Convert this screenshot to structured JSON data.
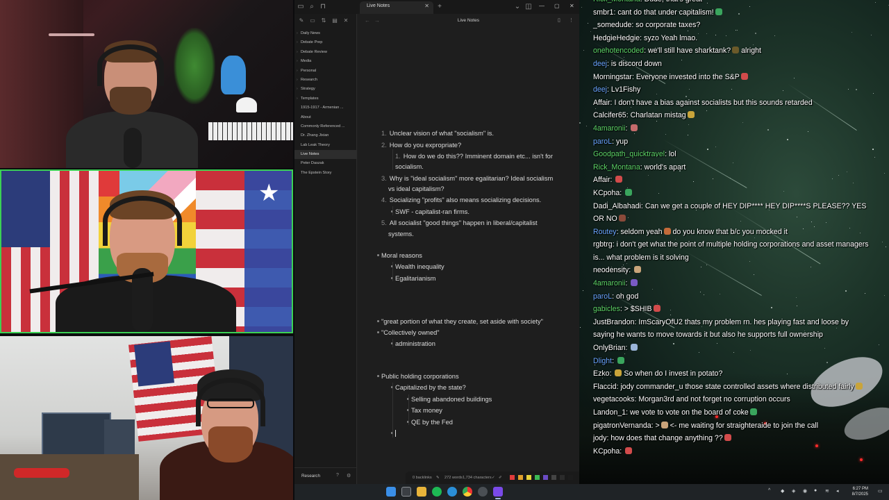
{
  "obsidian": {
    "tab_title": "Live Notes",
    "note_title": "Live Notes",
    "vault_name": "Research",
    "sidebar_items": [
      {
        "label": "Daily News",
        "folder": true
      },
      {
        "label": "Debate Prep",
        "folder": true
      },
      {
        "label": "Debate Review",
        "folder": true
      },
      {
        "label": "Media",
        "folder": true
      },
      {
        "label": "Personal",
        "folder": true
      },
      {
        "label": "Research",
        "folder": true
      },
      {
        "label": "Strategy",
        "folder": true
      },
      {
        "label": "Templates",
        "folder": true
      },
      {
        "label": "1915-1917 - Armenian ...",
        "folder": false
      },
      {
        "label": "About",
        "folder": false
      },
      {
        "label": "Commonly Referenced ...",
        "folder": false
      },
      {
        "label": "Dr. Zhang Jixian",
        "folder": false
      },
      {
        "label": "Lab Leak Theory",
        "folder": false
      },
      {
        "label": "Live Notes",
        "folder": false,
        "active": true
      },
      {
        "label": "Peter Daszak",
        "folder": false
      },
      {
        "label": "The Epstein Story",
        "folder": false
      }
    ],
    "note_lines": [
      {
        "type": "num",
        "num": "1.",
        "text": "Unclear vision of what \"socialism\" is.",
        "indent": 0
      },
      {
        "type": "num",
        "num": "2.",
        "text": "How do you expropriate?",
        "indent": 0
      },
      {
        "type": "num",
        "num": "1.",
        "text": "How do we do this?? Imminent domain etc... isn't for",
        "indent": 1
      },
      {
        "type": "cont",
        "text": "socialism.",
        "indent": 1
      },
      {
        "type": "num",
        "num": "3.",
        "text": "Why is \"ideal socialism\" more egalitarian? Ideal socialism",
        "indent": 0
      },
      {
        "type": "cont",
        "text": "vs ideal capitalism?",
        "indent": 0
      },
      {
        "type": "num",
        "num": "4.",
        "text": "Socializing \"profits\" also means socializing decisions.",
        "indent": 0
      },
      {
        "type": "bullet",
        "text": "SWF - capitalist-ran firms.",
        "indent": 1
      },
      {
        "type": "num",
        "num": "5.",
        "text": "All socialist \"good things\" happen in liberal/capitalist",
        "indent": 0
      },
      {
        "type": "cont",
        "text": "systems.",
        "indent": 0
      },
      {
        "type": "bullet",
        "text": "Moral reasons",
        "indent": 0
      },
      {
        "type": "bullet",
        "text": "Wealth inequality",
        "indent": 1
      },
      {
        "type": "bullet",
        "text": "Egalitarianism",
        "indent": 1
      },
      {
        "type": "bullet",
        "text": "\"great portion of what they create, set aside with society\"",
        "indent": 0
      },
      {
        "type": "bullet",
        "text": "\"Collectively owned\"",
        "indent": 0
      },
      {
        "type": "bullet",
        "text": "administration",
        "indent": 1
      },
      {
        "type": "bullet",
        "text": "Public holding corporations",
        "indent": 0
      },
      {
        "type": "bullet",
        "text": "Capitalized by the state?",
        "indent": 1
      },
      {
        "type": "bullet",
        "text": "Selling abandoned buildings",
        "indent": 2
      },
      {
        "type": "bullet",
        "text": "Tax money",
        "indent": 2
      },
      {
        "type": "bullet",
        "text": "QE by the Fed",
        "indent": 2
      },
      {
        "type": "bullet",
        "text": "",
        "indent": 1
      }
    ],
    "status": {
      "backlinks": "0 backlinks",
      "words": "272 words",
      "characters": "1,734 characters"
    },
    "swatch_colors": [
      "#e03b3b",
      "#e0a02c",
      "#e8d23a",
      "#3cba54",
      "#6a4bc4",
      "#444444",
      "#2b2b2b",
      "#1c1c1c"
    ]
  },
  "chat": {
    "messages": [
      {
        "user": "Rick_Montana",
        "color": "#5fd86a",
        "text": "Dude, that's great"
      },
      {
        "user": "smbr1",
        "color": "#ffffff",
        "text": "cant do that under capitalism!",
        "emote": "#3aa55d"
      },
      {
        "user": "_somedude",
        "color": "#ffffff",
        "text": "so corporate taxes?"
      },
      {
        "user": "HedgieHedgie",
        "color": "#ffffff",
        "text": "syzo Yeah lmao."
      },
      {
        "user": "onehotencoded",
        "color": "#5fd86a",
        "text": "we'll still have sharktank?",
        "emote": "#6b5a2a",
        "tail": "alright"
      },
      {
        "user": "deej",
        "color": "#6aa6ff",
        "text": "is discord down"
      },
      {
        "user": "Morningstar",
        "color": "#ffffff",
        "text": "Everyone invested into the S&P",
        "emote": "#d24b4b"
      },
      {
        "user": "deej",
        "color": "#6aa6ff",
        "text": "Lv1Fishy"
      },
      {
        "user": "Affair",
        "color": "#ffffff",
        "text": "I don't have a bias against socialists but this sounds retarded"
      },
      {
        "user": "Calcifer65",
        "color": "#ffffff",
        "text": "Charlatan mistag",
        "emote": "#c9a43a"
      },
      {
        "user": "4amaronii",
        "color": "#5fd86a",
        "text": "",
        "emote": "#c46b6b"
      },
      {
        "user": "paroL",
        "color": "#6aa6ff",
        "text": "yup"
      },
      {
        "user": "Goodpath_quicktravel",
        "color": "#5fd86a",
        "text": "lol"
      },
      {
        "user": "Rick_Montana",
        "color": "#5fd86a",
        "text": "world's apart"
      },
      {
        "user": "Affair",
        "color": "#ffffff",
        "text": "",
        "emote": "#d24b4b"
      },
      {
        "user": "KCpoha",
        "color": "#ffffff",
        "text": "",
        "emote": "#3aa55d"
      },
      {
        "user": "Dadi_Albahadi",
        "color": "#ffffff",
        "text": "Can we get a couple of HEY DIP**** HEY DIP****S PLEASE?? YES OR NO",
        "emote": "#8a4a3a"
      },
      {
        "user": "Routey",
        "color": "#6aa6ff",
        "text": "seldom yeah",
        "emote": "#c46b3a",
        "tail": "do you know that b/c you mocked it"
      },
      {
        "user": "rgbtrg",
        "color": "#ffffff",
        "text": "i don't get what the point of multiple holding corporations and asset managers is... what problem is it solving"
      },
      {
        "user": "neodensity",
        "color": "#ffffff",
        "text": "",
        "emote": "#c9a47a"
      },
      {
        "user": "4amaronii",
        "color": "#5fd86a",
        "text": "",
        "emote": "#7a5ac4"
      },
      {
        "user": "paroL",
        "color": "#6aa6ff",
        "text": "oh god"
      },
      {
        "user": "gabicles",
        "color": "#5fd86a",
        "text": "> $SHIB",
        "emote": "#d24b4b"
      },
      {
        "user": "JustBrandon",
        "color": "#ffffff",
        "text": "ImScaryOfU2 thats my problem rn. hes playing fast and loose by saying he wants to move towards it but also he supports full ownership"
      },
      {
        "user": "OnlyBrian",
        "color": "#ffffff",
        "text": "",
        "emote": "#9ab4d8"
      },
      {
        "user": "Dlight",
        "color": "#6aa6ff",
        "text": "",
        "emote": "#3aa55d"
      },
      {
        "user": "Ezko",
        "color": "#ffffff",
        "text": "",
        "emote": "#c9a43a",
        "tail": "So when do I invest in potato?"
      },
      {
        "user": "Flaccid",
        "color": "#ffffff",
        "text": "jody commander_u those state controlled assets where distributed fairly",
        "emote": "#c9a43a"
      },
      {
        "user": "vegetacooks",
        "color": "#ffffff",
        "text": "Morgan3rd and not forget no corruption occurs"
      },
      {
        "user": "Landon_1",
        "color": "#ffffff",
        "text": "we vote to vote on the board of coke",
        "emote": "#3aa55d"
      },
      {
        "user": "pigatronVernanda",
        "color": "#ffffff",
        "text": ">",
        "emote": "#c9a47a",
        "tail": "<- me waiting for straighteraide to join the call"
      },
      {
        "user": "jody",
        "color": "#ffffff",
        "text": "how does that change anything ??",
        "emote": "#d24b4b"
      },
      {
        "user": "KCpoha",
        "color": "#ffffff",
        "text": "",
        "emote": "#d24b4b"
      }
    ]
  },
  "taskbar": {
    "time": "6:27 PM",
    "date": "8/7/2025"
  }
}
